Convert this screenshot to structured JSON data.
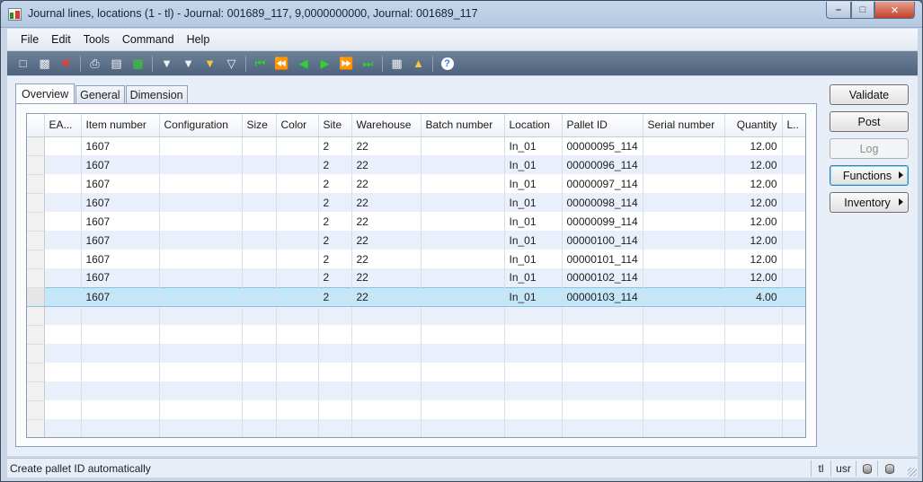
{
  "window": {
    "title": "Journal lines, locations (1 - tl) - Journal: 001689_117, 9,0000000000, Journal: 001689_117",
    "minimize_symbol": "–",
    "maximize_symbol": "□",
    "close_symbol": "✕"
  },
  "menu": [
    "File",
    "Edit",
    "Tools",
    "Command",
    "Help"
  ],
  "toolbar_icons": [
    {
      "name": "new-icon",
      "glyph": "🗋"
    },
    {
      "name": "save-icon",
      "glyph": "💾"
    },
    {
      "name": "delete-icon",
      "glyph": "✖"
    },
    {
      "name": "print-icon",
      "glyph": "⎙"
    },
    {
      "name": "print-preview-icon",
      "glyph": "🗐"
    },
    {
      "name": "export-excel-icon",
      "glyph": "▦"
    },
    {
      "name": "filter-by-selection-icon",
      "glyph": "⛛"
    },
    {
      "name": "filter-by-grid-icon",
      "glyph": "⛛"
    },
    {
      "name": "advanced-filter-icon",
      "glyph": "⛛"
    },
    {
      "name": "remove-filter-icon",
      "glyph": "⛛"
    },
    {
      "name": "first-record-icon",
      "glyph": "⏮"
    },
    {
      "name": "previous-page-icon",
      "glyph": "⏪"
    },
    {
      "name": "previous-record-icon",
      "glyph": "◀"
    },
    {
      "name": "next-record-icon",
      "glyph": "▶"
    },
    {
      "name": "next-page-icon",
      "glyph": "⏩"
    },
    {
      "name": "last-record-icon",
      "glyph": "⏭"
    },
    {
      "name": "document-handling-icon",
      "glyph": "📎"
    },
    {
      "name": "alert-icon",
      "glyph": "🔔"
    },
    {
      "name": "help-icon",
      "glyph": "?"
    }
  ],
  "tabs": [
    "Overview",
    "General",
    "Dimension"
  ],
  "grid": {
    "columns": [
      "EA...",
      "Item number",
      "Configuration",
      "Size",
      "Color",
      "Site",
      "Warehouse",
      "Batch number",
      "Location",
      "Pallet ID",
      "Serial number",
      "Quantity",
      "L.."
    ],
    "rows": [
      [
        "",
        "1607",
        "",
        "",
        "",
        "2",
        "22",
        "",
        "In_01",
        "00000095_114",
        "",
        "12.00",
        ""
      ],
      [
        "",
        "1607",
        "",
        "",
        "",
        "2",
        "22",
        "",
        "In_01",
        "00000096_114",
        "",
        "12.00",
        ""
      ],
      [
        "",
        "1607",
        "",
        "",
        "",
        "2",
        "22",
        "",
        "In_01",
        "00000097_114",
        "",
        "12.00",
        ""
      ],
      [
        "",
        "1607",
        "",
        "",
        "",
        "2",
        "22",
        "",
        "In_01",
        "00000098_114",
        "",
        "12.00",
        ""
      ],
      [
        "",
        "1607",
        "",
        "",
        "",
        "2",
        "22",
        "",
        "In_01",
        "00000099_114",
        "",
        "12.00",
        ""
      ],
      [
        "",
        "1607",
        "",
        "",
        "",
        "2",
        "22",
        "",
        "In_01",
        "00000100_114",
        "",
        "12.00",
        ""
      ],
      [
        "",
        "1607",
        "",
        "",
        "",
        "2",
        "22",
        "",
        "In_01",
        "00000101_114",
        "",
        "12.00",
        ""
      ],
      [
        "",
        "1607",
        "",
        "",
        "",
        "2",
        "22",
        "",
        "In_01",
        "00000102_114",
        "",
        "12.00",
        ""
      ],
      [
        "",
        "1607",
        "",
        "",
        "",
        "2",
        "22",
        "",
        "In_01",
        "00000103_114",
        "",
        "4.00",
        ""
      ]
    ],
    "selected_row": 8,
    "empty_rows": 7
  },
  "side_buttons": {
    "validate": "Validate",
    "post": "Post",
    "log": "Log",
    "functions": "Functions",
    "inventory": "Inventory"
  },
  "status": {
    "message": "Create pallet ID automatically",
    "company": "tl",
    "user": "usr"
  }
}
